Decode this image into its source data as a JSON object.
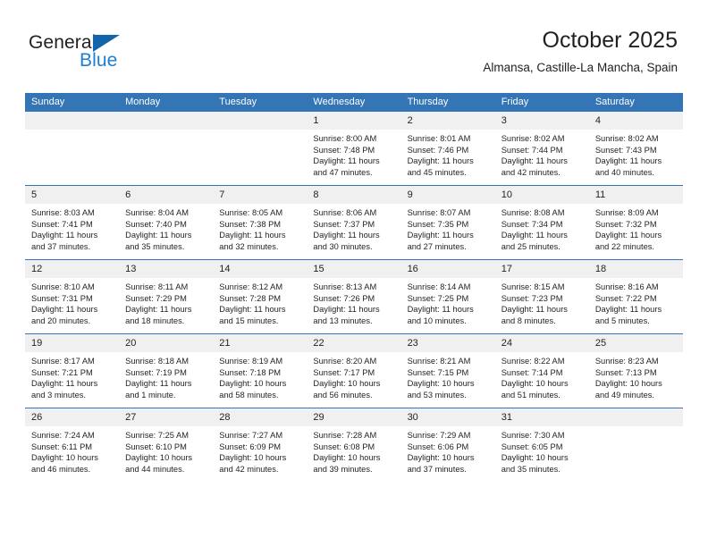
{
  "brand": {
    "name_part1": "General",
    "name_part2": "Blue",
    "logo_icon": "triangle-icon"
  },
  "header": {
    "title": "October 2025",
    "subtitle": "Almansa, Castille-La Mancha, Spain"
  },
  "colors": {
    "header_blue": "#3375b5",
    "brand_blue": "#1b7fd4",
    "logo_blue": "#1464aa",
    "daynum_bg": "#f0f0f0",
    "text": "#231f20"
  },
  "weekday_headers": [
    "Sunday",
    "Monday",
    "Tuesday",
    "Wednesday",
    "Thursday",
    "Friday",
    "Saturday"
  ],
  "weeks": [
    [
      {
        "day": "",
        "empty": true
      },
      {
        "day": "",
        "empty": true
      },
      {
        "day": "",
        "empty": true
      },
      {
        "day": "1",
        "sunrise": "Sunrise: 8:00 AM",
        "sunset": "Sunset: 7:48 PM",
        "daylight_1": "Daylight: 11 hours",
        "daylight_2": "and 47 minutes."
      },
      {
        "day": "2",
        "sunrise": "Sunrise: 8:01 AM",
        "sunset": "Sunset: 7:46 PM",
        "daylight_1": "Daylight: 11 hours",
        "daylight_2": "and 45 minutes."
      },
      {
        "day": "3",
        "sunrise": "Sunrise: 8:02 AM",
        "sunset": "Sunset: 7:44 PM",
        "daylight_1": "Daylight: 11 hours",
        "daylight_2": "and 42 minutes."
      },
      {
        "day": "4",
        "sunrise": "Sunrise: 8:02 AM",
        "sunset": "Sunset: 7:43 PM",
        "daylight_1": "Daylight: 11 hours",
        "daylight_2": "and 40 minutes."
      }
    ],
    [
      {
        "day": "5",
        "sunrise": "Sunrise: 8:03 AM",
        "sunset": "Sunset: 7:41 PM",
        "daylight_1": "Daylight: 11 hours",
        "daylight_2": "and 37 minutes."
      },
      {
        "day": "6",
        "sunrise": "Sunrise: 8:04 AM",
        "sunset": "Sunset: 7:40 PM",
        "daylight_1": "Daylight: 11 hours",
        "daylight_2": "and 35 minutes."
      },
      {
        "day": "7",
        "sunrise": "Sunrise: 8:05 AM",
        "sunset": "Sunset: 7:38 PM",
        "daylight_1": "Daylight: 11 hours",
        "daylight_2": "and 32 minutes."
      },
      {
        "day": "8",
        "sunrise": "Sunrise: 8:06 AM",
        "sunset": "Sunset: 7:37 PM",
        "daylight_1": "Daylight: 11 hours",
        "daylight_2": "and 30 minutes."
      },
      {
        "day": "9",
        "sunrise": "Sunrise: 8:07 AM",
        "sunset": "Sunset: 7:35 PM",
        "daylight_1": "Daylight: 11 hours",
        "daylight_2": "and 27 minutes."
      },
      {
        "day": "10",
        "sunrise": "Sunrise: 8:08 AM",
        "sunset": "Sunset: 7:34 PM",
        "daylight_1": "Daylight: 11 hours",
        "daylight_2": "and 25 minutes."
      },
      {
        "day": "11",
        "sunrise": "Sunrise: 8:09 AM",
        "sunset": "Sunset: 7:32 PM",
        "daylight_1": "Daylight: 11 hours",
        "daylight_2": "and 22 minutes."
      }
    ],
    [
      {
        "day": "12",
        "sunrise": "Sunrise: 8:10 AM",
        "sunset": "Sunset: 7:31 PM",
        "daylight_1": "Daylight: 11 hours",
        "daylight_2": "and 20 minutes."
      },
      {
        "day": "13",
        "sunrise": "Sunrise: 8:11 AM",
        "sunset": "Sunset: 7:29 PM",
        "daylight_1": "Daylight: 11 hours",
        "daylight_2": "and 18 minutes."
      },
      {
        "day": "14",
        "sunrise": "Sunrise: 8:12 AM",
        "sunset": "Sunset: 7:28 PM",
        "daylight_1": "Daylight: 11 hours",
        "daylight_2": "and 15 minutes."
      },
      {
        "day": "15",
        "sunrise": "Sunrise: 8:13 AM",
        "sunset": "Sunset: 7:26 PM",
        "daylight_1": "Daylight: 11 hours",
        "daylight_2": "and 13 minutes."
      },
      {
        "day": "16",
        "sunrise": "Sunrise: 8:14 AM",
        "sunset": "Sunset: 7:25 PM",
        "daylight_1": "Daylight: 11 hours",
        "daylight_2": "and 10 minutes."
      },
      {
        "day": "17",
        "sunrise": "Sunrise: 8:15 AM",
        "sunset": "Sunset: 7:23 PM",
        "daylight_1": "Daylight: 11 hours",
        "daylight_2": "and 8 minutes."
      },
      {
        "day": "18",
        "sunrise": "Sunrise: 8:16 AM",
        "sunset": "Sunset: 7:22 PM",
        "daylight_1": "Daylight: 11 hours",
        "daylight_2": "and 5 minutes."
      }
    ],
    [
      {
        "day": "19",
        "sunrise": "Sunrise: 8:17 AM",
        "sunset": "Sunset: 7:21 PM",
        "daylight_1": "Daylight: 11 hours",
        "daylight_2": "and 3 minutes."
      },
      {
        "day": "20",
        "sunrise": "Sunrise: 8:18 AM",
        "sunset": "Sunset: 7:19 PM",
        "daylight_1": "Daylight: 11 hours",
        "daylight_2": "and 1 minute."
      },
      {
        "day": "21",
        "sunrise": "Sunrise: 8:19 AM",
        "sunset": "Sunset: 7:18 PM",
        "daylight_1": "Daylight: 10 hours",
        "daylight_2": "and 58 minutes."
      },
      {
        "day": "22",
        "sunrise": "Sunrise: 8:20 AM",
        "sunset": "Sunset: 7:17 PM",
        "daylight_1": "Daylight: 10 hours",
        "daylight_2": "and 56 minutes."
      },
      {
        "day": "23",
        "sunrise": "Sunrise: 8:21 AM",
        "sunset": "Sunset: 7:15 PM",
        "daylight_1": "Daylight: 10 hours",
        "daylight_2": "and 53 minutes."
      },
      {
        "day": "24",
        "sunrise": "Sunrise: 8:22 AM",
        "sunset": "Sunset: 7:14 PM",
        "daylight_1": "Daylight: 10 hours",
        "daylight_2": "and 51 minutes."
      },
      {
        "day": "25",
        "sunrise": "Sunrise: 8:23 AM",
        "sunset": "Sunset: 7:13 PM",
        "daylight_1": "Daylight: 10 hours",
        "daylight_2": "and 49 minutes."
      }
    ],
    [
      {
        "day": "26",
        "sunrise": "Sunrise: 7:24 AM",
        "sunset": "Sunset: 6:11 PM",
        "daylight_1": "Daylight: 10 hours",
        "daylight_2": "and 46 minutes."
      },
      {
        "day": "27",
        "sunrise": "Sunrise: 7:25 AM",
        "sunset": "Sunset: 6:10 PM",
        "daylight_1": "Daylight: 10 hours",
        "daylight_2": "and 44 minutes."
      },
      {
        "day": "28",
        "sunrise": "Sunrise: 7:27 AM",
        "sunset": "Sunset: 6:09 PM",
        "daylight_1": "Daylight: 10 hours",
        "daylight_2": "and 42 minutes."
      },
      {
        "day": "29",
        "sunrise": "Sunrise: 7:28 AM",
        "sunset": "Sunset: 6:08 PM",
        "daylight_1": "Daylight: 10 hours",
        "daylight_2": "and 39 minutes."
      },
      {
        "day": "30",
        "sunrise": "Sunrise: 7:29 AM",
        "sunset": "Sunset: 6:06 PM",
        "daylight_1": "Daylight: 10 hours",
        "daylight_2": "and 37 minutes."
      },
      {
        "day": "31",
        "sunrise": "Sunrise: 7:30 AM",
        "sunset": "Sunset: 6:05 PM",
        "daylight_1": "Daylight: 10 hours",
        "daylight_2": "and 35 minutes."
      },
      {
        "day": "",
        "empty": true
      }
    ]
  ]
}
